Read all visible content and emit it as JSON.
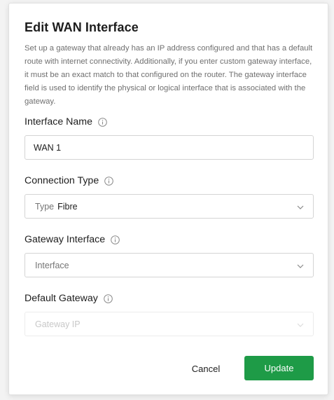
{
  "dialog": {
    "title": "Edit WAN Interface",
    "description": "Set up a gateway that already has an IP address configured and that has a default route with internet connectivity. Additionally, if you enter custom gateway interface, it must be an exact match to that configured on the router. The gateway interface field is used to identify the physical or logical interface that is associated with the gateway."
  },
  "fields": {
    "interface_name": {
      "label": "Interface Name",
      "value": "WAN 1",
      "info_icon": "info-circle-icon"
    },
    "connection_type": {
      "label": "Connection Type",
      "prefix": "Type",
      "value": "Fibre",
      "info_icon": "info-circle-icon"
    },
    "gateway_interface": {
      "label": "Gateway Interface",
      "placeholder": "Interface",
      "info_icon": "info-circle-icon"
    },
    "default_gateway": {
      "label": "Default Gateway",
      "placeholder": "Gateway IP",
      "disabled": true,
      "info_icon": "info-circle-icon"
    }
  },
  "actions": {
    "cancel_label": "Cancel",
    "update_label": "Update"
  },
  "colors": {
    "primary": "#1e9b47",
    "border": "#d4d4d4",
    "muted_text": "#6f6f6f"
  }
}
